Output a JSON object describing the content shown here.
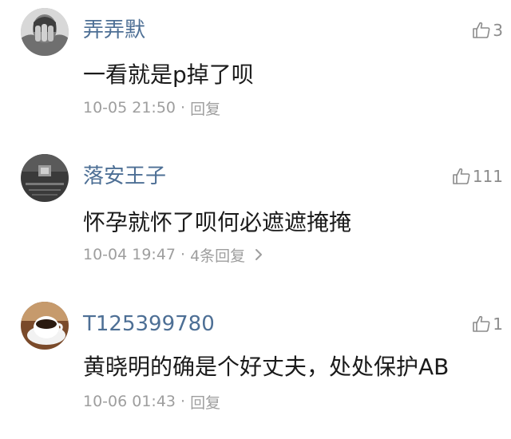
{
  "comments": [
    {
      "username": "弄弄默",
      "likes": "3",
      "text": "一看就是p掉了呗",
      "time": "10-05 21:50",
      "separator": "·",
      "reply_label": "回复",
      "avatar_icon": "person-covering-face-icon"
    },
    {
      "username": "落安王子",
      "likes": "111",
      "text": "怀孕就怀了呗何必遮遮掩掩",
      "time": "10-04 19:47",
      "separator": "·",
      "reply_label": "4条回复",
      "reply_chevron": "chevron-right-icon",
      "avatar_icon": "dark-photo-icon"
    },
    {
      "username": "T125399780",
      "likes": "1",
      "text": "黄晓明的确是个好丈夫，处处保护AB",
      "time": "10-06 01:43",
      "separator": "·",
      "reply_label": "回复",
      "avatar_icon": "coffee-cup-icon"
    }
  ],
  "colors": {
    "username": "#4d6f95",
    "text": "#1a1a1a",
    "meta": "#9e9e9e",
    "like": "#8c8c8c",
    "background": "#ffffff"
  },
  "icons": {
    "like": "thumbs-up-icon"
  }
}
